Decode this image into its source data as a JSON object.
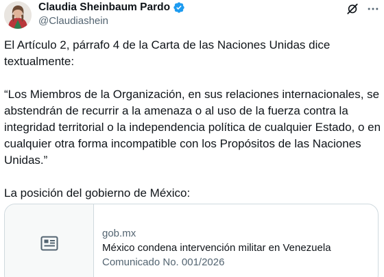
{
  "author": {
    "display_name": "Claudia Sheinbaum Pardo",
    "handle": "@Claudiashein",
    "verified": true,
    "verified_color": "#1d9bf0"
  },
  "header_icons": [
    "grok-icon",
    "more-icon"
  ],
  "more_label": "···",
  "tweet": {
    "paragraphs": [
      "El Artículo 2, párrafo 4 de la Carta de las Naciones Unidas dice textualmente:",
      "“Los Miembros de la Organización, en sus relaciones internacionales, se abstendrán de recurrir a la amenaza o al uso de la fuerza contra la integridad territorial o la independencia política de cualquier Estado, o en cualquier otra forma incompatible con los Propósitos de las Naciones Unidas.”",
      "La posición del gobierno de México:"
    ]
  },
  "link_card": {
    "icon": "article-icon",
    "domain": "gob.mx",
    "title": "México condena intervención militar en Venezuela",
    "description": "Comunicado No. 001/2026"
  },
  "colors": {
    "text": "#0f1419",
    "secondary": "#536471",
    "border": "#cfd9de"
  }
}
